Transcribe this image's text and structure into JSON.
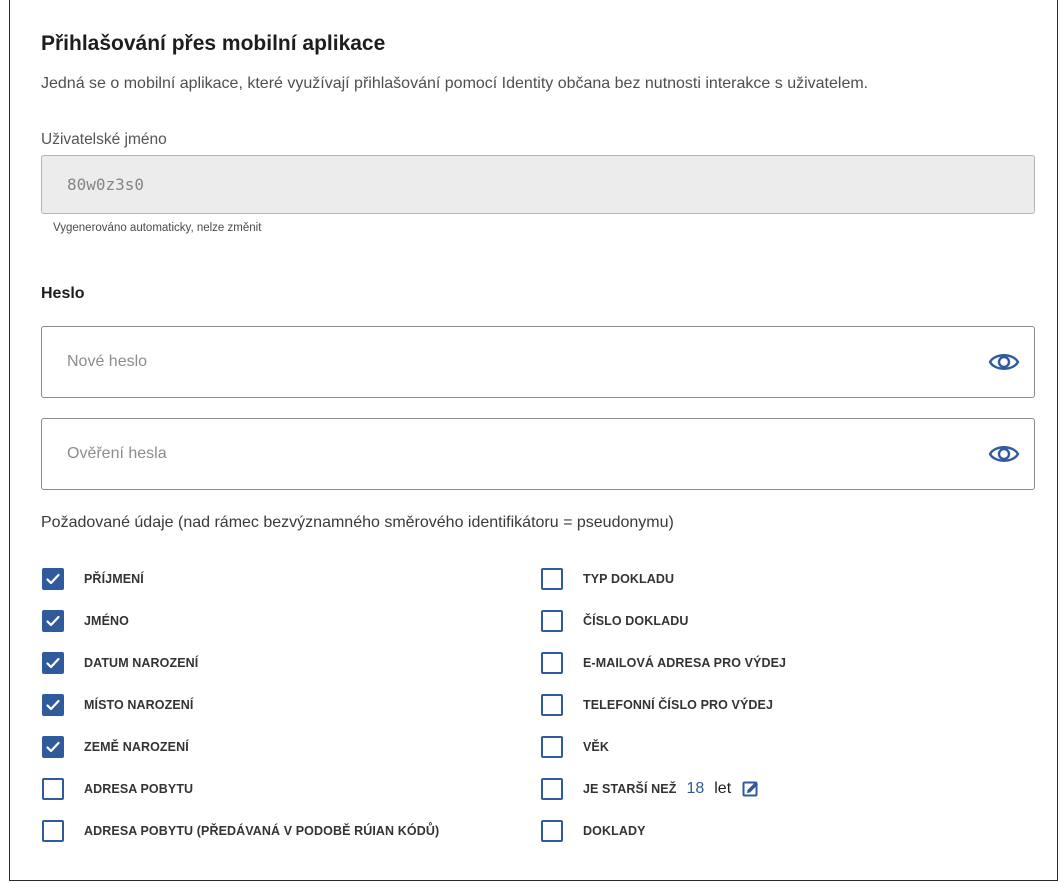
{
  "section": {
    "title": "Přihlašování přes mobilní aplikace",
    "description": "Jedná se o mobilní aplikace, které využívají přihlašování pomocí Identity občana bez nutnosti interakce s uživatelem."
  },
  "username": {
    "label": "Uživatelské jméno",
    "value": "80w0z3s0",
    "hint": "Vygenerováno automaticky, nelze změnit"
  },
  "password": {
    "label": "Heslo",
    "new_placeholder": "Nové heslo",
    "confirm_placeholder": "Ověření hesla",
    "toggle_icon": "eye-icon"
  },
  "required_data": {
    "label": "Požadované údaje (nad rámec bezvýznamného směrového identifikátoru = pseudonymu)",
    "left_column": [
      {
        "label": "PŘÍJMENÍ",
        "checked": true
      },
      {
        "label": "JMÉNO",
        "checked": true
      },
      {
        "label": "DATUM NAROZENÍ",
        "checked": true
      },
      {
        "label": "MÍSTO NAROZENÍ",
        "checked": true
      },
      {
        "label": "ZEMĚ NAROZENÍ",
        "checked": true
      },
      {
        "label": "ADRESA POBYTU",
        "checked": false
      },
      {
        "label": "ADRESA POBYTU (PŘEDÁVANÁ V PODOBĚ RÚIAN KÓDŮ)",
        "checked": false
      }
    ],
    "right_column": [
      {
        "label": "TYP DOKLADU",
        "checked": false
      },
      {
        "label": "ČÍSLO DOKLADU",
        "checked": false
      },
      {
        "label": "E-MAILOVÁ ADRESA PRO VÝDEJ",
        "checked": false
      },
      {
        "label": "TELEFONNÍ ČÍSLO PRO VÝDEJ",
        "checked": false
      },
      {
        "label": "VĚK",
        "checked": false
      },
      {
        "label": "JE STARŠÍ NEŽ",
        "checked": false,
        "age_value": "18",
        "age_unit": "let",
        "edit_icon": "edit-icon"
      },
      {
        "label": "DOKLADY",
        "checked": false
      }
    ]
  },
  "colors": {
    "accent": "#2f5b9c",
    "readonly_bg": "#ececec"
  }
}
